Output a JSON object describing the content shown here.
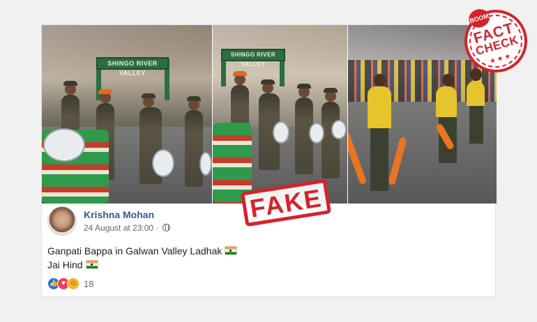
{
  "post": {
    "author": "Krishna Mohan",
    "timestamp": "24 August at 23:00",
    "separator": "·",
    "privacy_icon": "globe-icon",
    "line1": "Ganpati Bappa in Galwan Valley Ladhak",
    "line2": "Jai Hind",
    "reactions": [
      "like-icon",
      "love-icon",
      "care-icon"
    ],
    "reaction_count": "18"
  },
  "video_frames": {
    "signboard_text": "SHINGO RIVER VALLEY"
  },
  "overlays": {
    "fake_stamp": "FAKE",
    "badge_brand": "BOOM",
    "badge_line1": "FACT",
    "badge_line2": "CHECK",
    "badge_stars": "★★★"
  },
  "colors": {
    "stamp_red": "#d4232b",
    "author_blue": "#385898"
  }
}
